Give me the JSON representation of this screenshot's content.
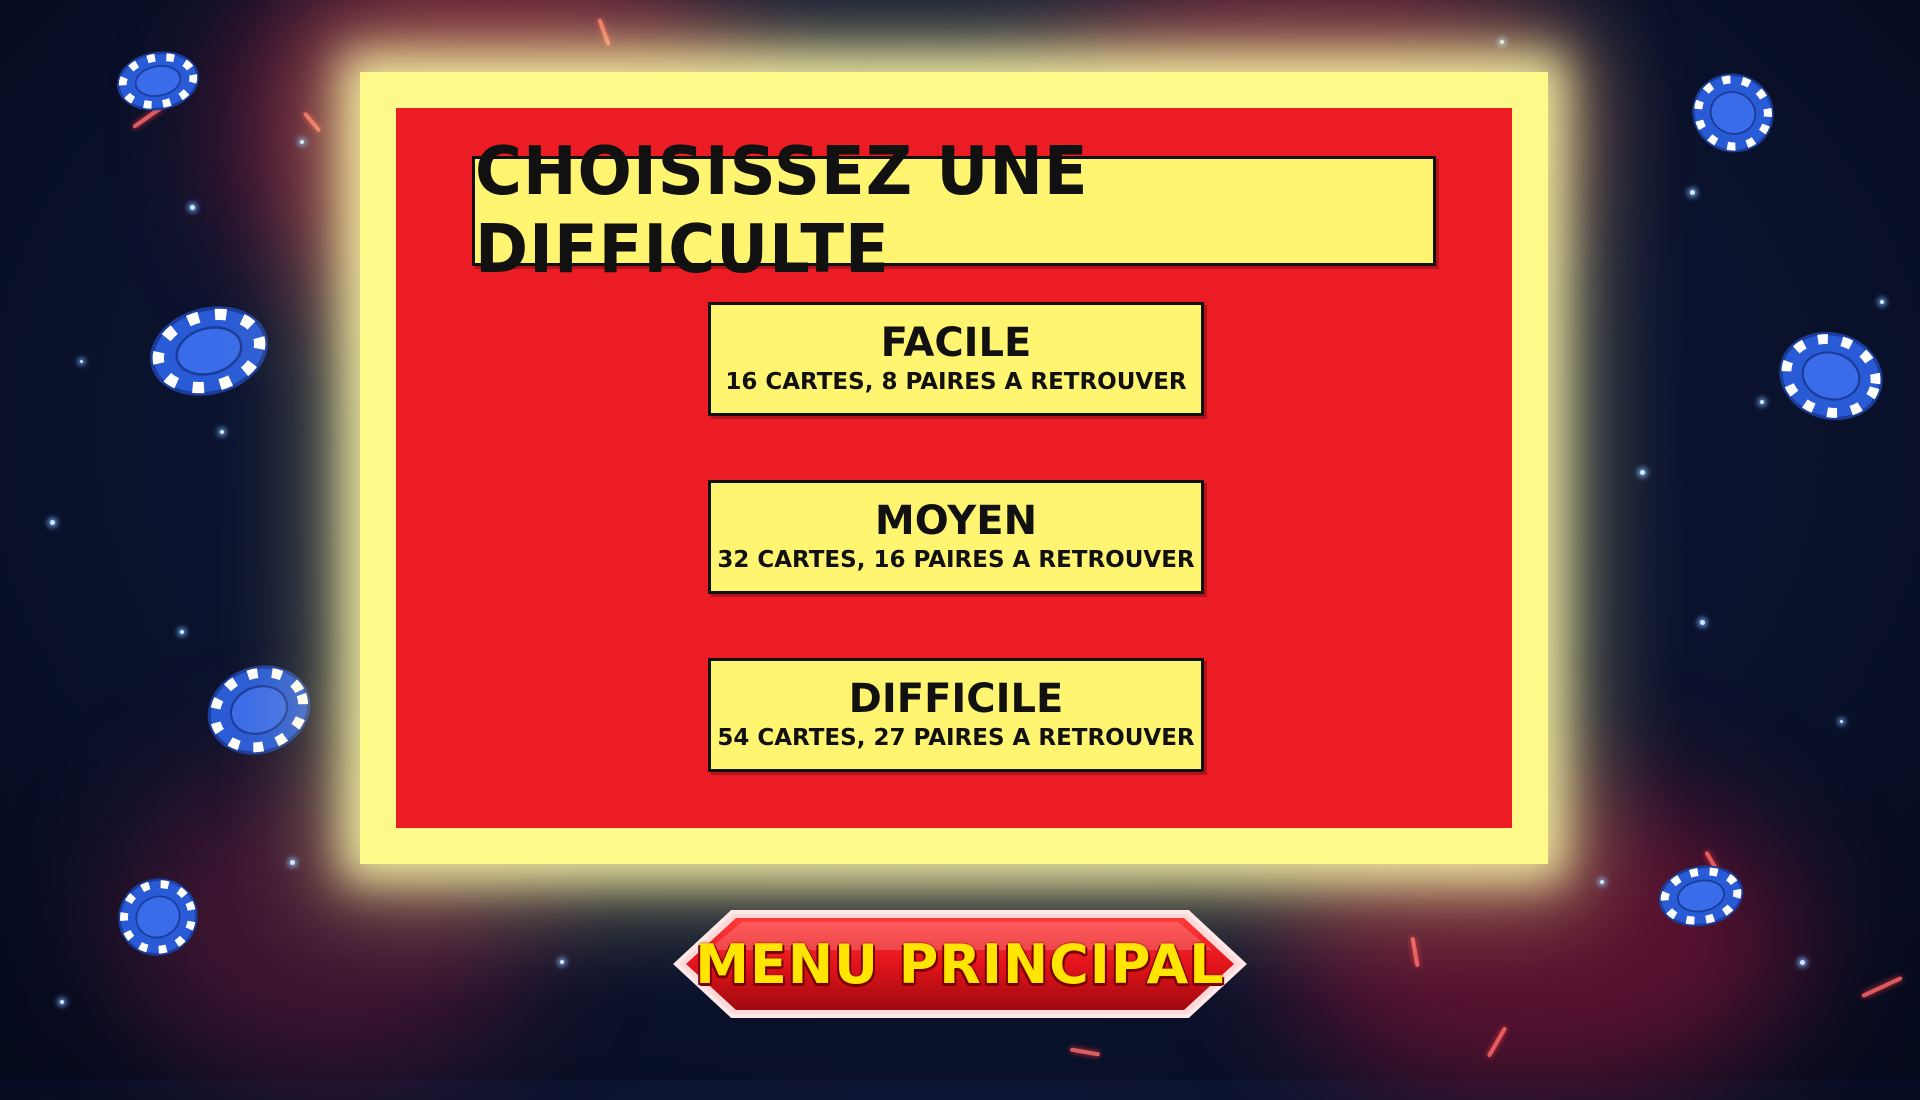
{
  "screen": {
    "title": "CHOISISSEZ UNE DIFFICULTE",
    "options": [
      {
        "name": "FACILE",
        "description": "16 CARTES, 8 PAIRES A RETROUVER"
      },
      {
        "name": "MOYEN",
        "description": "32 CARTES, 16 PAIRES A RETROUVER"
      },
      {
        "name": "DIFFICILE",
        "description": "54 CARTES, 27 PAIRES A RETROUVER"
      }
    ]
  },
  "menu_button": {
    "label": "MENU PRINCIPAL"
  },
  "colors": {
    "panel_frame": "#fff98a",
    "panel_fill": "#ec1c24",
    "button_fill": "#fff570",
    "menu_button_red": "#e3141b",
    "menu_text": "#ffe500",
    "chip_blue": "#2a5bd7"
  },
  "decorations": {
    "chip_icon": "poker-chip-icon"
  }
}
